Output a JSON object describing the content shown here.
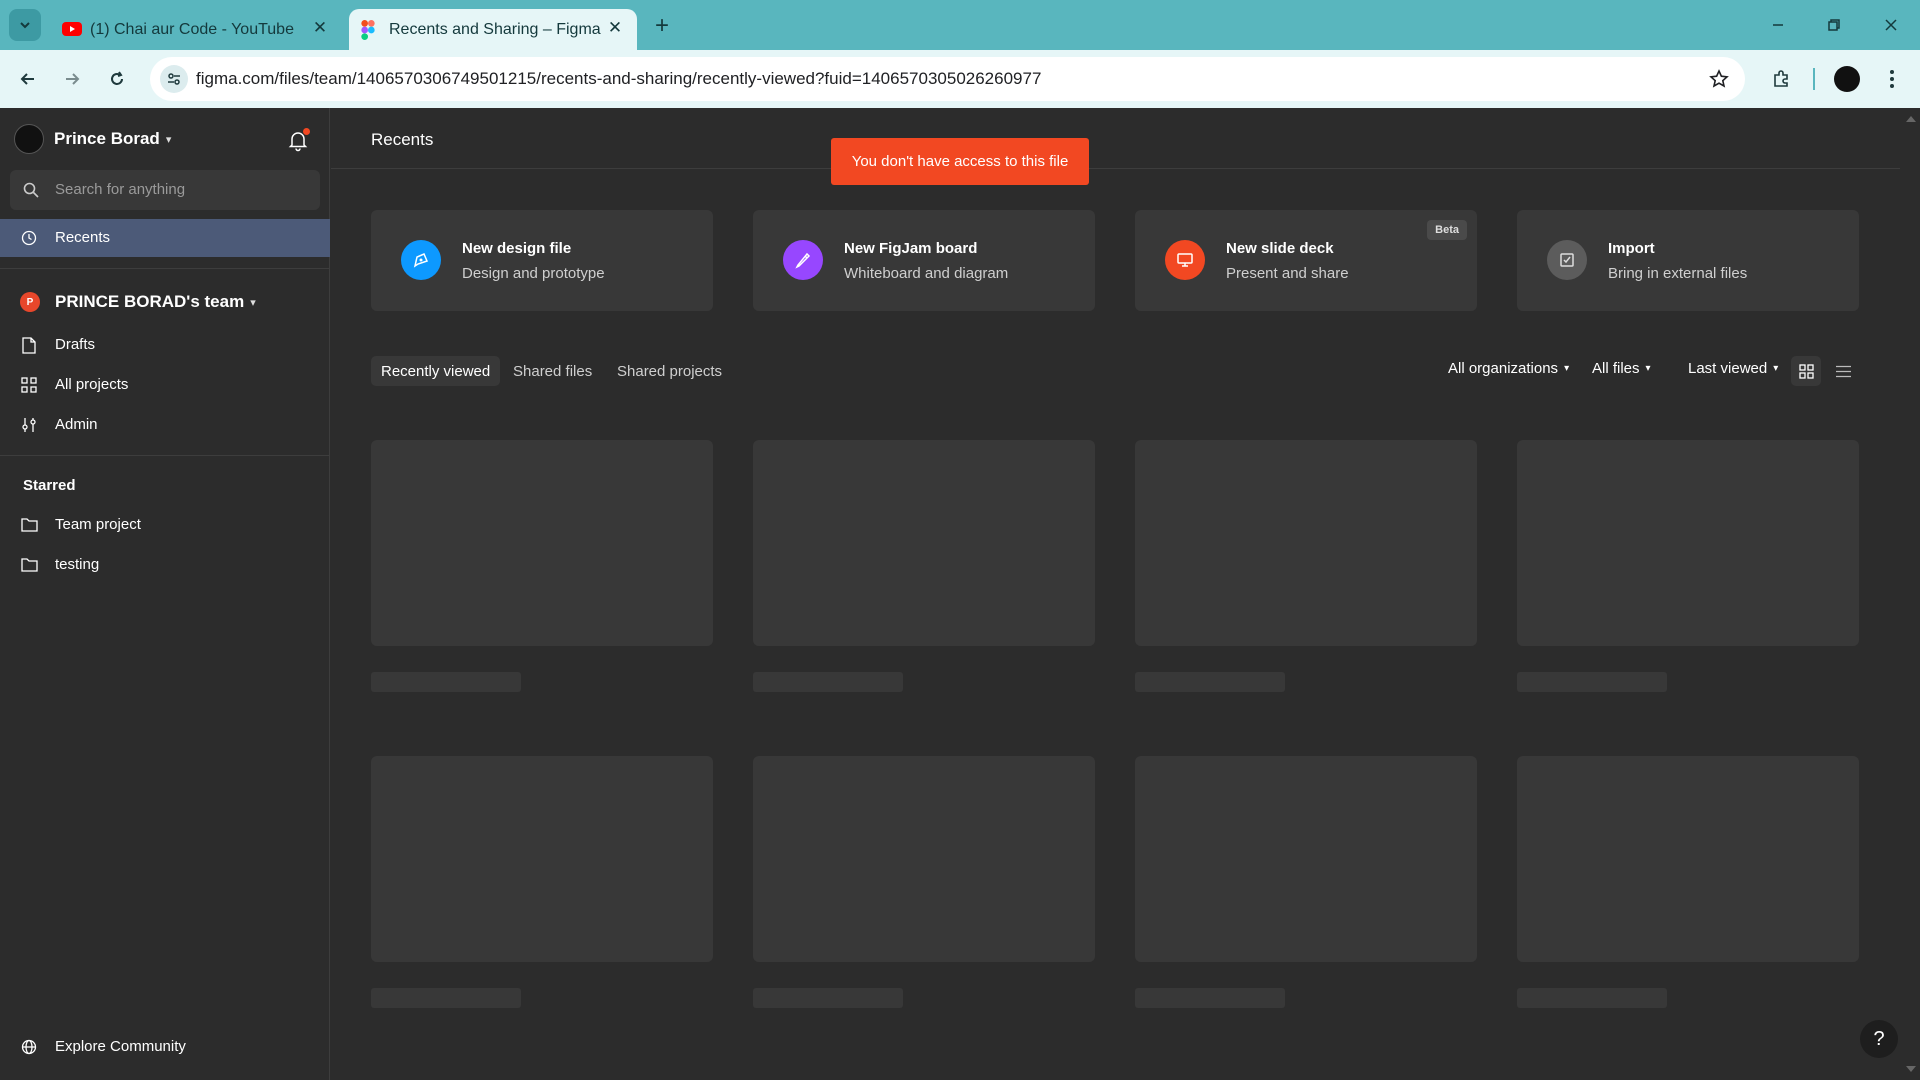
{
  "browser": {
    "tabs": [
      {
        "title": "(1) Chai aur Code - YouTube",
        "active": false,
        "favicon": "youtube-icon"
      },
      {
        "title": "Recents and Sharing – Figma",
        "active": true,
        "favicon": "figma-icon"
      }
    ],
    "url": "figma.com/files/team/1406570306749501215/recents-and-sharing/recently-viewed?fuid=1406570305026260977",
    "accent_color": "#59b6be"
  },
  "sidebar": {
    "username": "Prince Borad",
    "search_placeholder": "Search for anything",
    "recents_label": "Recents",
    "team": {
      "badge": "P",
      "name": "PRINCE BORAD's team"
    },
    "team_items": [
      {
        "label": "Drafts",
        "icon": "file-icon"
      },
      {
        "label": "All projects",
        "icon": "grid-icon"
      },
      {
        "label": "Admin",
        "icon": "sliders-icon"
      }
    ],
    "starred_title": "Starred",
    "starred_items": [
      {
        "label": "Team project",
        "icon": "folder-icon"
      },
      {
        "label": "testing",
        "icon": "folder-icon"
      }
    ],
    "explore_label": "Explore Community"
  },
  "main": {
    "title": "Recents",
    "toast": "You don't have access to this file",
    "create_cards": [
      {
        "title": "New design file",
        "subtitle": "Design and prototype",
        "icon": "pen-tool-icon",
        "color": "#0d99ff"
      },
      {
        "title": "New FigJam board",
        "subtitle": "Whiteboard and diagram",
        "icon": "marker-icon",
        "color": "#9747ff"
      },
      {
        "title": "New slide deck",
        "subtitle": "Present and share",
        "icon": "presentation-icon",
        "color": "#f24822",
        "badge": "Beta"
      },
      {
        "title": "Import",
        "subtitle": "Bring in external files",
        "icon": "import-icon",
        "color": "#5c5c5c"
      }
    ],
    "tabs": [
      "Recently viewed",
      "Shared files",
      "Shared projects"
    ],
    "filters": [
      "All organizations",
      "All files",
      "Last viewed"
    ],
    "toast_color": "#f24822",
    "selected_color": "#4c5a78"
  }
}
